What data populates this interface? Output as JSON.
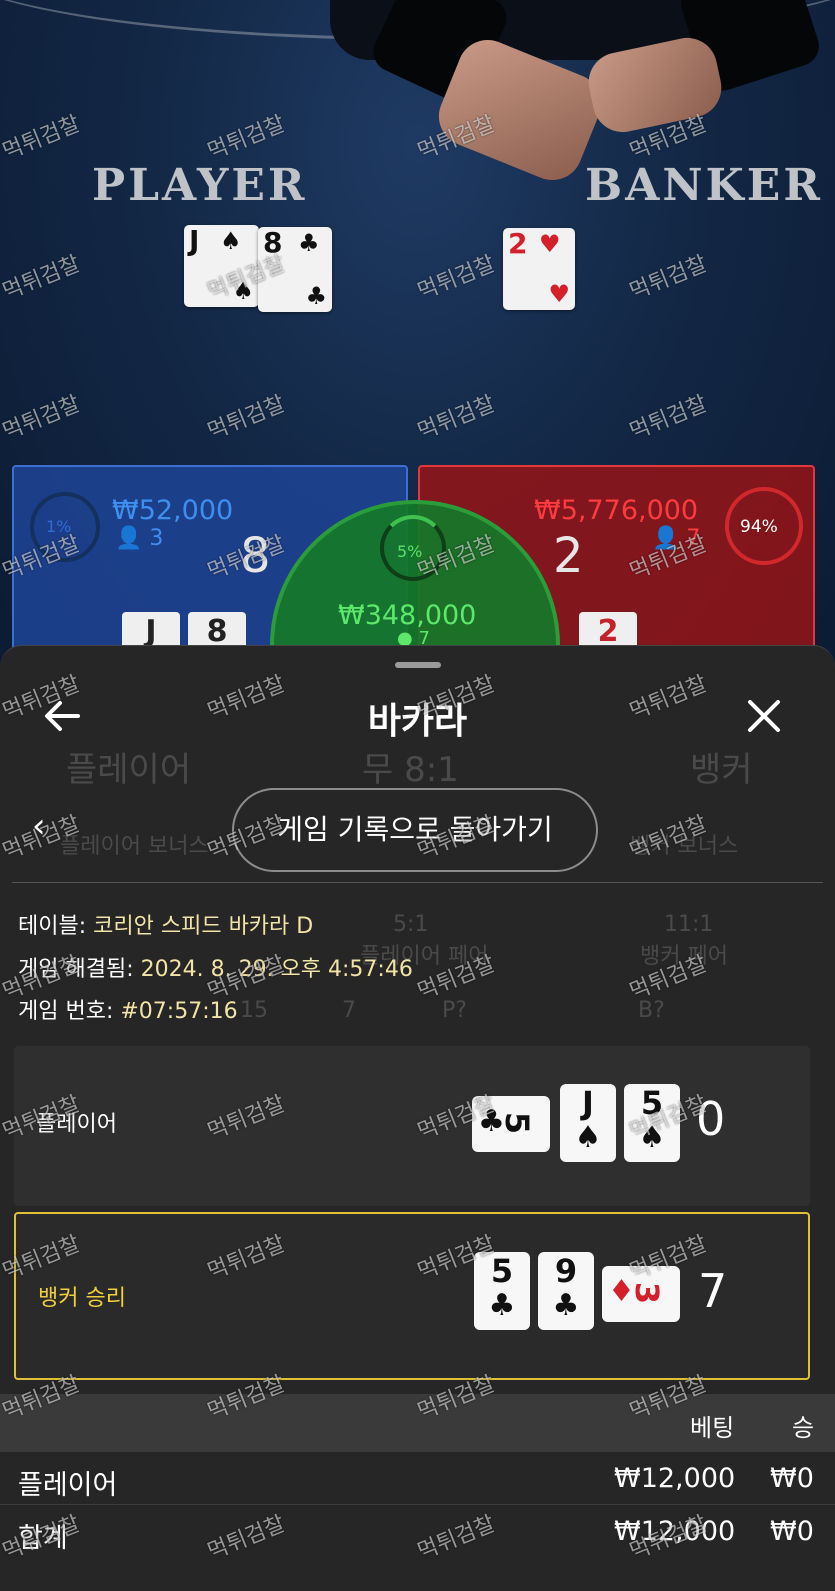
{
  "video": {
    "player_label": "PLAYER",
    "banker_label": "BANKER",
    "player_cards": [
      {
        "rank": "J",
        "suit": "♠",
        "color": "black"
      },
      {
        "rank": "8",
        "suit": "♣",
        "color": "black"
      }
    ],
    "banker_cards": [
      {
        "rank": "2",
        "suit": "♥",
        "color": "red"
      }
    ]
  },
  "scoreboard": {
    "player": {
      "percent": "1%",
      "amount": "₩52,000",
      "count": "3",
      "score": "8",
      "cards": [
        "J",
        "8"
      ],
      "suits": [
        "♠",
        "♣"
      ]
    },
    "tie": {
      "percent": "5%",
      "amount": "₩348,000",
      "count": "7"
    },
    "banker": {
      "percent": "94%",
      "amount": "₩5,776,000",
      "count": "7",
      "score": "2",
      "cards": [
        "2"
      ],
      "suits": [
        "♥"
      ]
    }
  },
  "sheet": {
    "title": "바카라",
    "return_button": "게임 기록으로 돌아가기",
    "behind": {
      "player": "플레이어",
      "tie": "무 8:1",
      "banker": "뱅커",
      "player_bonus": "플레이어 보너스",
      "banker_bonus": "뱅커 보너스",
      "pair_p": "5:1",
      "pair_b": "11:1",
      "pair_p_label": "플레이어 페어",
      "pair_b_label": "뱅커 페어",
      "road1": "15",
      "road2": "7",
      "road3": "P?",
      "road4": "B?"
    },
    "info": {
      "table_label": "테이블:",
      "table_value": "코리안 스피드 바카라 D",
      "resolved_label": "게임 해결됨:",
      "resolved_value": "2024. 8. 29. 오후 4:57:46",
      "game_no_label": "게임 번호:",
      "game_no_value": "#07:57:16"
    },
    "player_hand": {
      "label": "플레이어",
      "score": "0",
      "cards": [
        {
          "rank": "5",
          "suit": "♣",
          "orientation": "horizontal",
          "color": "black"
        },
        {
          "rank": "J",
          "suit": "♠",
          "orientation": "vertical",
          "color": "black"
        },
        {
          "rank": "5",
          "suit": "♠",
          "orientation": "vertical",
          "color": "black"
        }
      ]
    },
    "banker_hand": {
      "label": "뱅커 승리",
      "score": "7",
      "cards": [
        {
          "rank": "5",
          "suit": "♣",
          "orientation": "vertical",
          "color": "black"
        },
        {
          "rank": "9",
          "suit": "♣",
          "orientation": "vertical",
          "color": "black"
        },
        {
          "rank": "3",
          "suit": "♦",
          "orientation": "horizontal",
          "color": "red"
        }
      ]
    },
    "bets_table": {
      "headers": {
        "bet": "베팅",
        "win": "승"
      },
      "rows": [
        {
          "label": "플레이어",
          "bet": "₩12,000",
          "win": "₩0"
        },
        {
          "label": "합계",
          "bet": "₩12,000",
          "win": "₩0"
        }
      ]
    }
  },
  "watermark": "먹튀검찰",
  "colors": {
    "accent_gold": "#e0c034",
    "player_blue": "#3f8ff0",
    "banker_red": "#ff3b3f",
    "tie_green": "#5de86b"
  }
}
